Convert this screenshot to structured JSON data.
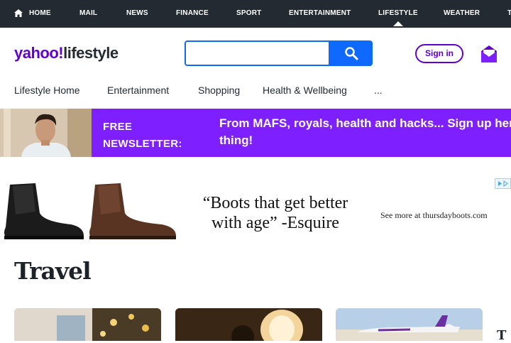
{
  "topnav": {
    "items": [
      "HOME",
      "MAIL",
      "NEWS",
      "FINANCE",
      "SPORT",
      "ENTERTAINMENT",
      "LIFESTYLE",
      "WEATHER",
      "T"
    ],
    "active": "LIFESTYLE"
  },
  "header": {
    "logo_brand": "yahoo!",
    "logo_section": "lifestyle",
    "search_placeholder": "",
    "signin_label": "Sign in"
  },
  "subnav": {
    "items": [
      "Lifestyle Home",
      "Entertainment",
      "Shopping",
      "Health & Wellbeing",
      "..."
    ]
  },
  "banner": {
    "label_line1": "FREE",
    "label_line2": "NEWSLETTER:",
    "text": "From MAFS, royals, health and hacks... Sign up here thing!"
  },
  "ad": {
    "quote_line1": "“Boots that get better",
    "quote_line2": "with age” -Esquire",
    "see_more": "See more at thursdayboots.com"
  },
  "section": {
    "title": "Travel",
    "peek_letter": "T"
  },
  "colors": {
    "topnav_bg": "#232a31",
    "brand_purple": "#6001d2",
    "banner_purple": "#7e1fff",
    "search_blue": "#0f69ff"
  }
}
